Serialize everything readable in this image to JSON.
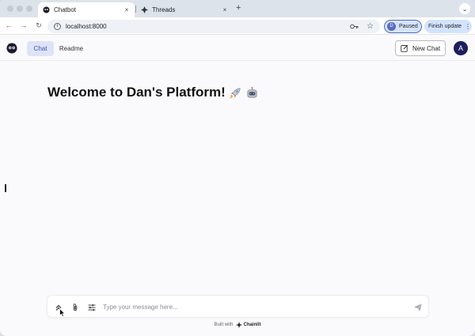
{
  "browser": {
    "tabs": [
      {
        "title": "Chatbot",
        "active": true
      },
      {
        "title": "Threads",
        "active": false
      }
    ],
    "new_tab": "+",
    "close_glyph": "×",
    "url": "localhost:8000",
    "profile": {
      "initial": "D",
      "status": "Paused"
    },
    "finish_update": "Finish update"
  },
  "app": {
    "nav": [
      {
        "label": "Chat",
        "active": true
      },
      {
        "label": "Readme",
        "active": false
      }
    ],
    "new_chat_label": "New Chat",
    "avatar_initial": "A",
    "welcome": "Welcome to Dan's Platform!",
    "composer": {
      "placeholder": "Type your message here..."
    },
    "footer": {
      "built_with": "Built with",
      "brand": "Chainlit"
    }
  },
  "colors": {
    "accent": "#3a50c9",
    "avatar": "#1c1f5c",
    "chip": "#d3e3fd"
  },
  "icons": [
    "chatbot-favicon",
    "threads-favicon",
    "back-icon",
    "forward-icon",
    "reload-icon",
    "info-icon",
    "key-icon",
    "star-icon",
    "app-logo",
    "edit-icon",
    "chevron-up-icon",
    "paperclip-icon",
    "settings-sliders-icon",
    "send-icon",
    "rocket-emoji",
    "robot-emoji"
  ]
}
